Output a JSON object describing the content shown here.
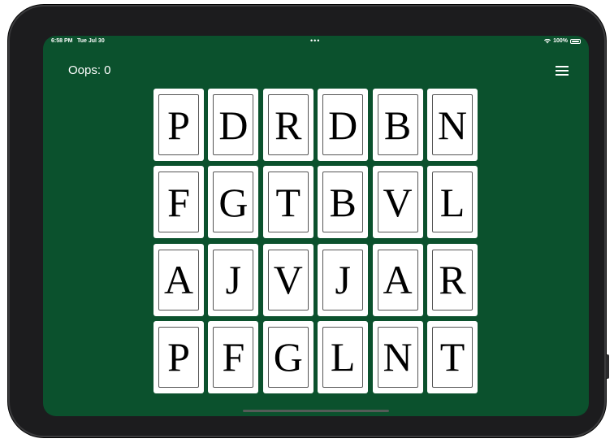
{
  "status_bar": {
    "time": "6:58 PM",
    "date": "Tue Jul 30",
    "dots": "•••",
    "battery": "100%",
    "wifi_icon": "wifi-icon",
    "battery_icon": "battery-icon"
  },
  "game": {
    "oops_label": "Oops: 0",
    "menu_icon": "hamburger-menu-icon",
    "board_color": "#0b512d",
    "cards": [
      [
        "P",
        "D",
        "R",
        "D",
        "B",
        "N"
      ],
      [
        "F",
        "G",
        "T",
        "B",
        "V",
        "L"
      ],
      [
        "A",
        "J",
        "V",
        "J",
        "A",
        "R"
      ],
      [
        "P",
        "F",
        "G",
        "L",
        "N",
        "T"
      ]
    ]
  }
}
